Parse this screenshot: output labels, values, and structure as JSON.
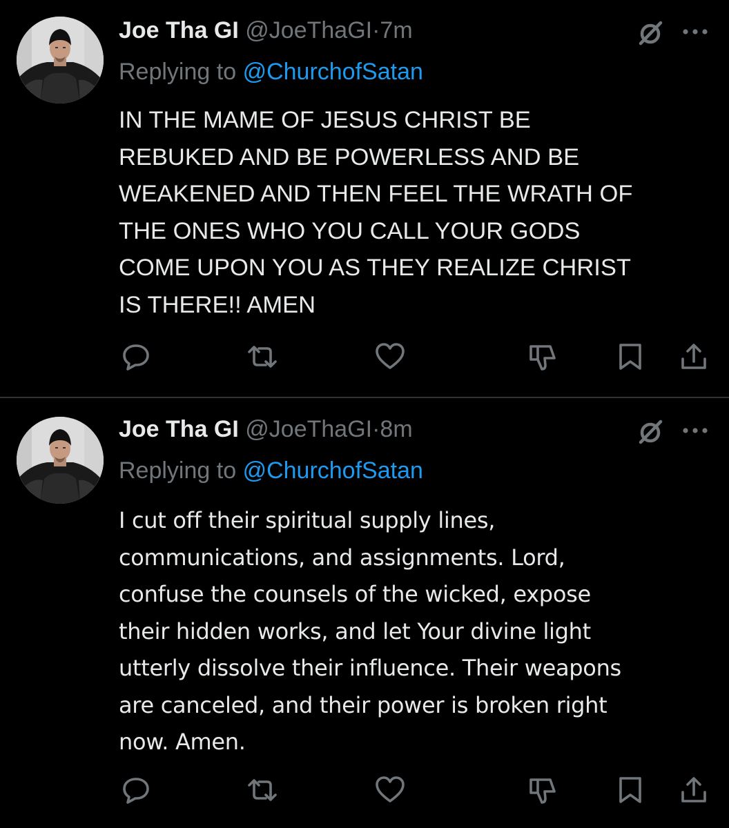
{
  "tweets": [
    {
      "display_name": "Joe Tha GI",
      "handle": "@JoeThaGI",
      "separator": "·",
      "time": "7m",
      "replying_prefix": "Replying to",
      "replying_to": "@ChurchofSatan",
      "text": "IN THE MAME OF JESUS CHRIST BE REBUKED AND BE POWERLESS AND BE WEAKENED AND THEN FEEL THE WRATH OF THE ONES WHO YOU CALL YOUR GODS COME UPON YOU AS THEY REALIZE CHRIST IS THERE!! AMEN",
      "text_lines": [
        "IN THE MAME OF JESUS CHRIST BE",
        "REBUKED AND BE POWERLESS AND BE",
        "WEAKENED AND THEN FEEL THE WRATH OF",
        "THE ONES WHO YOU CALL YOUR GODS",
        "COME UPON YOU AS THEY REALIZE CHRIST",
        "IS THERE!! AMEN"
      ],
      "actions": [
        "reply-icon",
        "retweet-icon",
        "like-icon",
        "downvote-icon",
        "bookmark-icon",
        "share-icon"
      ]
    },
    {
      "display_name": "Joe Tha GI",
      "handle": "@JoeThaGI",
      "separator": "·",
      "time": "8m",
      "replying_prefix": "Replying to",
      "replying_to": "@ChurchofSatan",
      "text": "I cut off their spiritual supply lines, communications, and assignments. Lord, confuse the counsels of the wicked, expose their hidden works, and let Your divine light utterly dissolve their influence. Their weapons are canceled, and their power is broken right now. Amen.",
      "text_lines": [
        "I cut off their spiritual supply lines,",
        "communications, and assignments. Lord,",
        "confuse the counsels of the wicked, expose",
        "their hidden works, and let Your divine light",
        "utterly dissolve their influence. Their weapons",
        "are canceled, and their power is broken right",
        "now. Amen."
      ],
      "actions": [
        "reply-icon",
        "retweet-icon",
        "like-icon",
        "downvote-icon",
        "bookmark-icon",
        "share-icon"
      ]
    }
  ],
  "colors": {
    "background": "#000000",
    "text_primary": "#e7e9ea",
    "text_secondary": "#71767b",
    "link": "#1d9bf0",
    "divider": "#2f3336"
  }
}
